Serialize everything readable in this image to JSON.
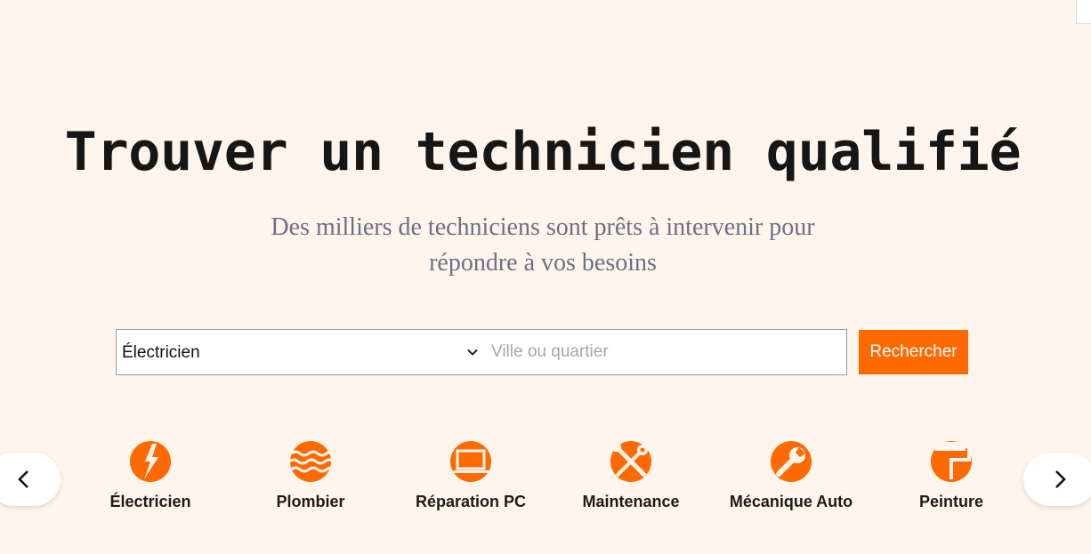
{
  "hero": {
    "title": "Trouver un technicien qualifié",
    "subtitle_line1": "Des milliers de techniciens sont prêts à intervenir pour",
    "subtitle_line2": "répondre à vos besoins"
  },
  "search": {
    "selected_category": "Électricien",
    "location_placeholder": "Ville ou quartier",
    "location_value": "",
    "button_label": "Rechercher"
  },
  "categories": [
    {
      "label": "Électricien",
      "icon": "lightning-icon"
    },
    {
      "label": "Plombier",
      "icon": "water-waves-icon"
    },
    {
      "label": "Réparation PC",
      "icon": "monitor-icon"
    },
    {
      "label": "Maintenance",
      "icon": "tools-icon"
    },
    {
      "label": "Mécanique Auto",
      "icon": "wrench-icon"
    },
    {
      "label": "Peinture",
      "icon": "paint-roller-icon"
    }
  ],
  "carousel": {
    "prev_icon": "chevron-left-icon",
    "next_icon": "chevron-right-icon"
  },
  "colors": {
    "accent": "#ff6a00",
    "background": "#fff5ec",
    "title": "#161616",
    "subtitle": "#6c6f84"
  }
}
